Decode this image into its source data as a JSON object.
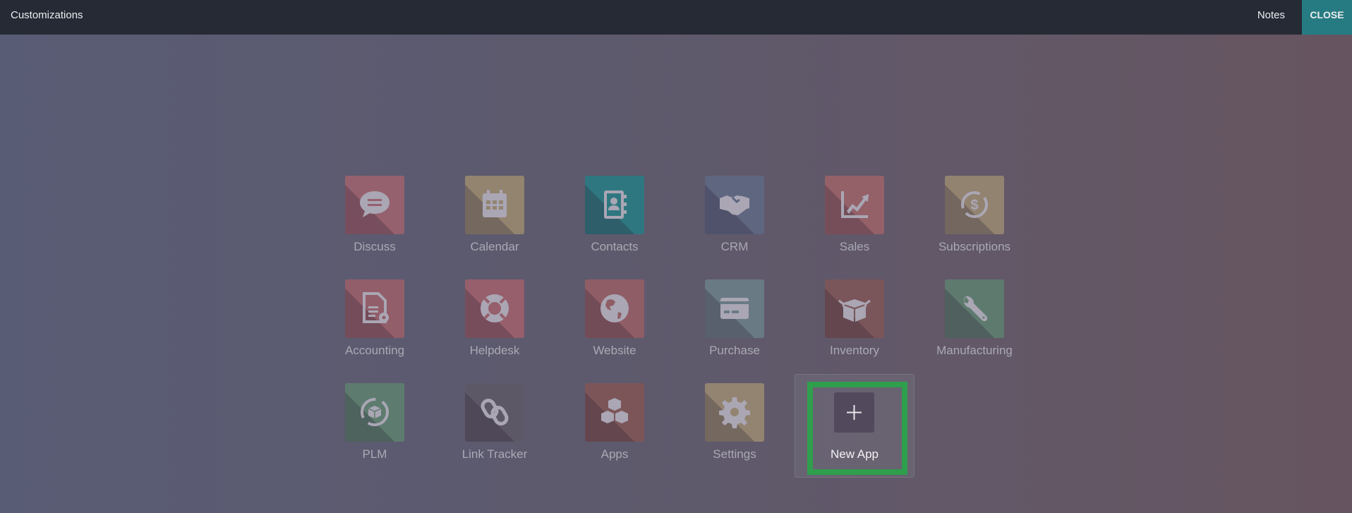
{
  "header": {
    "title": "Customizations",
    "notes_label": "Notes",
    "close_label": "CLOSE"
  },
  "colors": {
    "header_bg": "#262a35",
    "close_bg": "#267b82",
    "highlight": "#2f9e4d",
    "icon_glyph": "#aaa6b4"
  },
  "apps": [
    {
      "label": "Discuss",
      "icon": "chat-bubble-icon",
      "color": "#96616e"
    },
    {
      "label": "Calendar",
      "icon": "calendar-icon",
      "color": "#938470"
    },
    {
      "label": "Contacts",
      "icon": "address-book-icon",
      "color": "#2f7780"
    },
    {
      "label": "CRM",
      "icon": "handshake-icon",
      "color": "#5e6680"
    },
    {
      "label": "Sales",
      "icon": "chart-line-icon",
      "color": "#946168"
    },
    {
      "label": "Subscriptions",
      "icon": "dollar-cycle-icon",
      "color": "#928370"
    },
    {
      "label": "Accounting",
      "icon": "document-gear-icon",
      "color": "#925e69"
    },
    {
      "label": "Helpdesk",
      "icon": "lifebuoy-icon",
      "color": "#965f6b"
    },
    {
      "label": "Website",
      "icon": "globe-icon",
      "color": "#8f5d65"
    },
    {
      "label": "Purchase",
      "icon": "credit-card-icon",
      "color": "#6a7a85"
    },
    {
      "label": "Inventory",
      "icon": "open-box-icon",
      "color": "#7a5559"
    },
    {
      "label": "Manufacturing",
      "icon": "wrench-icon",
      "color": "#5e7a6f"
    },
    {
      "label": "PLM",
      "icon": "box-cycle-icon",
      "color": "#5d7c6f"
    },
    {
      "label": "Link Tracker",
      "icon": "chain-link-icon",
      "color": "#5d5866"
    },
    {
      "label": "Apps",
      "icon": "cubes-icon",
      "color": "#7c5559"
    },
    {
      "label": "Settings",
      "icon": "gear-icon",
      "color": "#928470"
    }
  ],
  "new_app": {
    "label": "New App",
    "icon": "plus-icon"
  }
}
